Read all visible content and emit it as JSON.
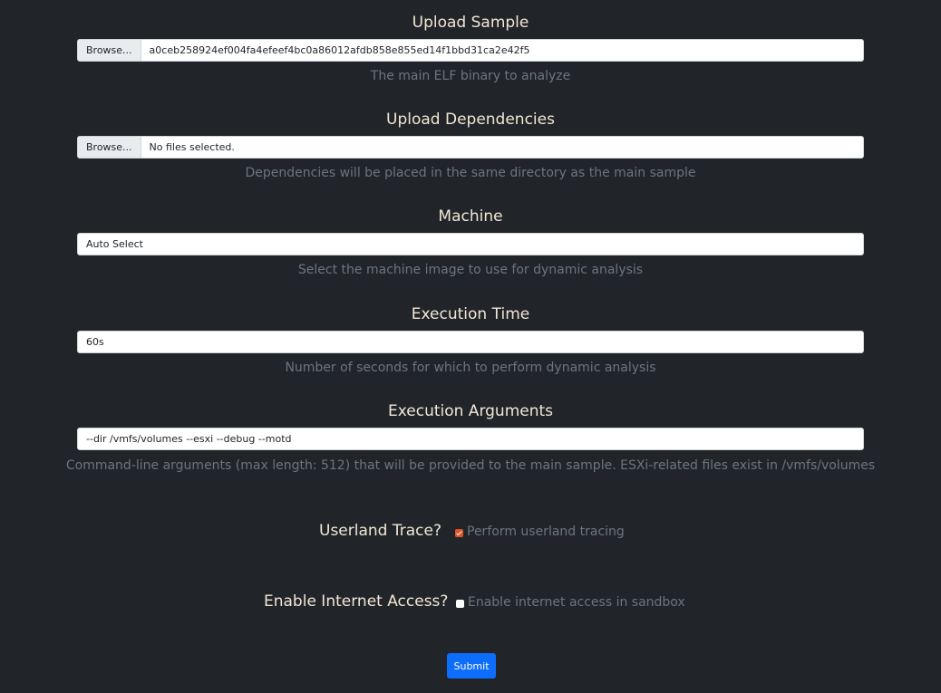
{
  "upload_sample": {
    "title": "Upload Sample",
    "browse_label": "Browse...",
    "file_name": "a0ceb258924ef004fa4efeef4bc0a86012afdb858e855ed14f1bbd31ca2e42f5",
    "help": "The main ELF binary to analyze"
  },
  "upload_dependencies": {
    "title": "Upload Dependencies",
    "browse_label": "Browse...",
    "file_name": "No files selected.",
    "help": "Dependencies will be placed in the same directory as the main sample"
  },
  "machine": {
    "title": "Machine",
    "value": "Auto Select",
    "help": "Select the machine image to use for dynamic analysis"
  },
  "execution_time": {
    "title": "Execution Time",
    "value": "60s",
    "help": "Number of seconds for which to perform dynamic analysis"
  },
  "execution_arguments": {
    "title": "Execution Arguments",
    "value": "--dir /vmfs/volumes --esxi --debug --motd",
    "help": "Command-line arguments (max length: 512) that will be provided to the main sample. ESXi-related files exist in /vmfs/volumes"
  },
  "userland_trace": {
    "label": "Userland Trace?",
    "checked": true,
    "checkbox_text": "Perform userland tracing"
  },
  "internet_access": {
    "label": "Enable Internet Access?",
    "checked": false,
    "checkbox_text": "Enable internet access in sandbox"
  },
  "submit_label": "Submit",
  "colors": {
    "background": "#212529",
    "heading": "#f1e6d5",
    "help_text": "#6c757d",
    "checkbox_checked": "#e0532a",
    "submit": "#0d6efd"
  }
}
